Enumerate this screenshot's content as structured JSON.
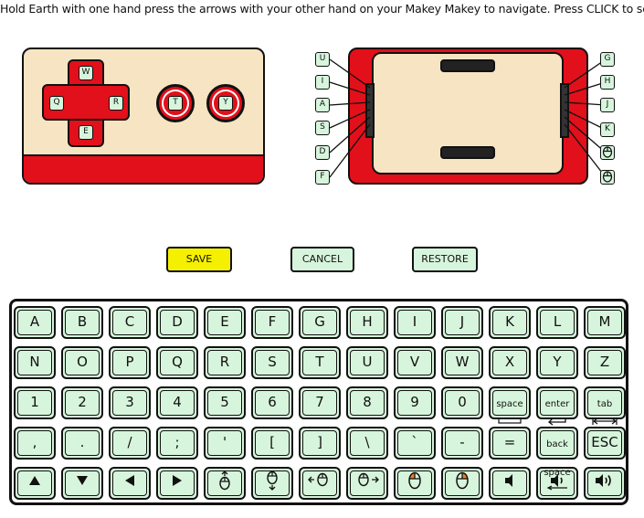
{
  "instruction": "Hold Earth with one hand press the arrows with your other hand on your Makey Makey to navigate. Press CLICK to select",
  "colors": {
    "red": "#e2101a",
    "cream": "#f7e4c3",
    "mint": "#d7f5dc",
    "yellow": "#f5f000",
    "orange": "#f08020"
  },
  "front_controller": {
    "dpad": {
      "up": "W",
      "left": "Q",
      "right": "R",
      "down": "E"
    },
    "buttons": [
      "T",
      "Y"
    ]
  },
  "back_controller": {
    "left_keys": [
      "U",
      "I",
      "A",
      "S",
      "D",
      "F"
    ],
    "right_keys": [
      "G",
      "H",
      "J",
      "K"
    ],
    "right_mouse_icons": [
      "mouse-icon",
      "mouse-icon"
    ]
  },
  "actions": {
    "save": "SAVE",
    "cancel": "CANCEL",
    "restore": "RESTORE"
  },
  "keyboard": {
    "row1": [
      "A",
      "B",
      "C",
      "D",
      "E",
      "F",
      "G",
      "H",
      "I",
      "J",
      "K",
      "L",
      "M"
    ],
    "row2": [
      "N",
      "O",
      "P",
      "Q",
      "R",
      "S",
      "T",
      "U",
      "V",
      "W",
      "X",
      "Y",
      "Z"
    ],
    "row3": [
      "1",
      "2",
      "3",
      "4",
      "5",
      "6",
      "7",
      "8",
      "9",
      "0"
    ],
    "row3_special": {
      "space": "space",
      "enter": "enter",
      "tab": "tab"
    },
    "row4": [
      ",",
      ".",
      "/",
      ";",
      "'",
      "[",
      "]",
      "\\",
      "`",
      "-",
      "="
    ],
    "row4_special": {
      "backspace_line1": "back",
      "backspace_line2": "space",
      "esc": "ESC"
    },
    "row5_icons": [
      "arrow-up-icon",
      "arrow-down-icon",
      "arrow-left-icon",
      "arrow-right-icon",
      "mouse-up-icon",
      "mouse-down-icon",
      "mouse-left-icon",
      "mouse-right-icon",
      "mouse-left-click-icon",
      "mouse-right-click-icon",
      "volume-mute-icon",
      "volume-low-icon",
      "volume-high-icon"
    ]
  }
}
